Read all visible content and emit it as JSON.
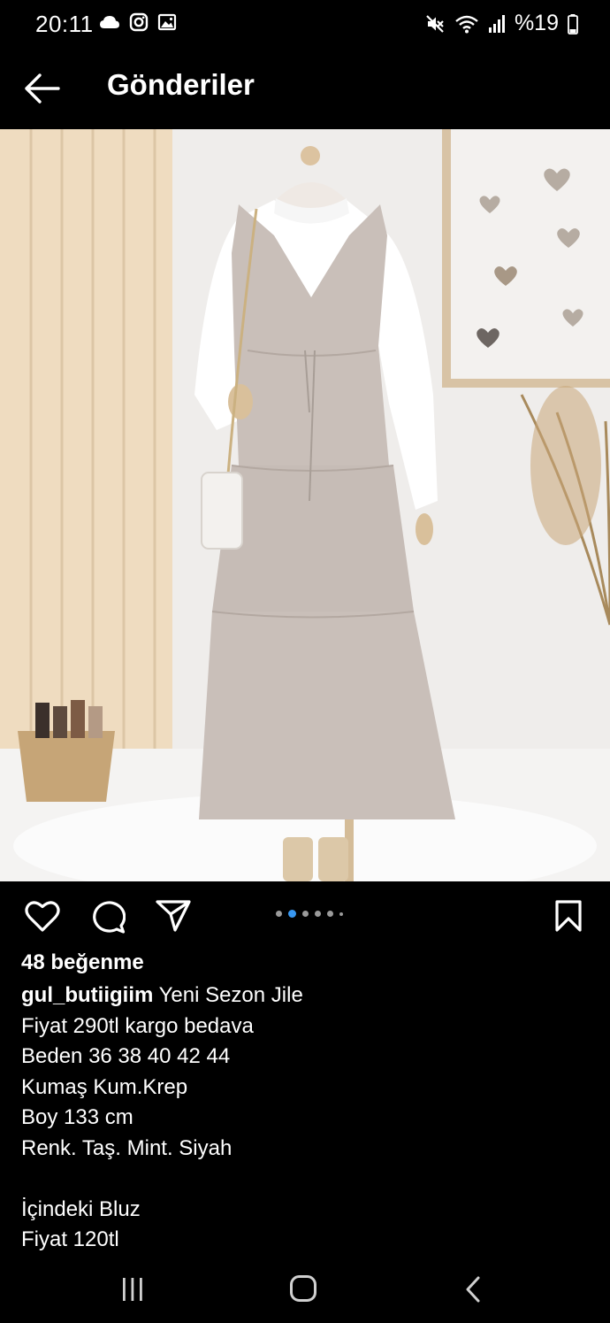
{
  "status_bar": {
    "time": "20:11",
    "left_icons": [
      "cloud-icon",
      "instagram-icon",
      "gallery-icon"
    ],
    "right_icons": [
      "mute-icon",
      "wifi-icon",
      "signal-icon",
      "battery-icon"
    ],
    "battery": "%19"
  },
  "header": {
    "title": "Gönderiler"
  },
  "post": {
    "carousel": {
      "count": 6,
      "active_index": 1
    },
    "likes": "48 beğenme",
    "username": "gul_butiigiim",
    "caption_first": "Yeni Sezon Jile",
    "caption_rest": "Fiyat 290tl kargo bedava\nBeden 36 38 40 42 44\nKumaş Kum.Krep\nBoy 133 cm\nRenk. Taş. Mint. Siyah\n\nİçindeki Bluz\nFiyat 120tl"
  },
  "colors": {
    "accent": "#3897f0",
    "background": "#000000",
    "dress": "#c9bfb9"
  }
}
